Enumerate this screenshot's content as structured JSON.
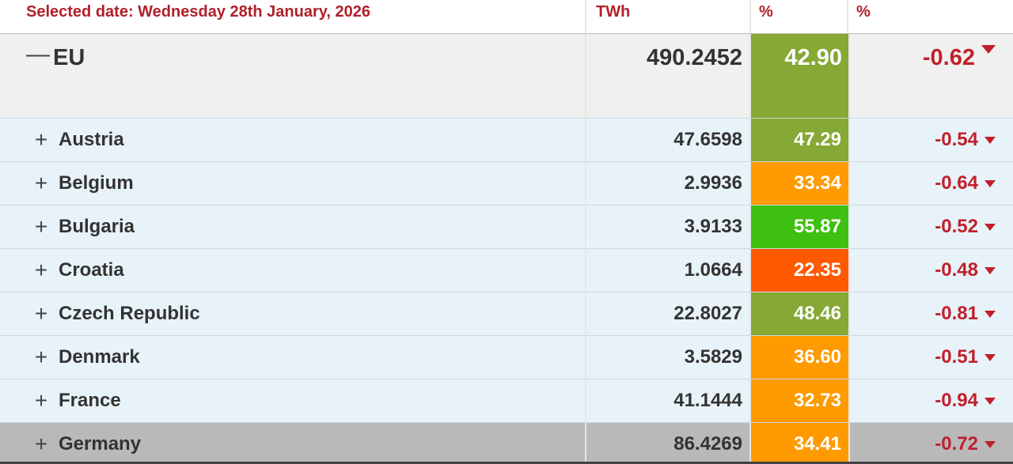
{
  "header": {
    "selected_date": "Selected date: Wednesday 28th January, 2026",
    "col_twh": "TWh",
    "col_pct": "%",
    "col_change": "%"
  },
  "colors": {
    "header_text": "#b0202a",
    "negative": "#c0202c",
    "pct_green_dark": "#86a834",
    "pct_green_bright": "#3fbf0f",
    "pct_orange": "#ff9a00",
    "pct_red_orange": "#ff5a00"
  },
  "eu": {
    "toggle": "—",
    "name": "EU",
    "twh": "490.2452",
    "pct": "42.90",
    "pct_color": "#86a834",
    "change": "-0.62"
  },
  "rows": [
    {
      "toggle": "+",
      "name": "Austria",
      "twh": "47.6598",
      "pct": "47.29",
      "pct_color": "#86a834",
      "change": "-0.54"
    },
    {
      "toggle": "+",
      "name": "Belgium",
      "twh": "2.9936",
      "pct": "33.34",
      "pct_color": "#ff9a00",
      "change": "-0.64"
    },
    {
      "toggle": "+",
      "name": "Bulgaria",
      "twh": "3.9133",
      "pct": "55.87",
      "pct_color": "#3fbf0f",
      "change": "-0.52"
    },
    {
      "toggle": "+",
      "name": "Croatia",
      "twh": "1.0664",
      "pct": "22.35",
      "pct_color": "#ff5a00",
      "change": "-0.48"
    },
    {
      "toggle": "+",
      "name": "Czech Republic",
      "twh": "22.8027",
      "pct": "48.46",
      "pct_color": "#86a834",
      "change": "-0.81"
    },
    {
      "toggle": "+",
      "name": "Denmark",
      "twh": "3.5829",
      "pct": "36.60",
      "pct_color": "#ff9a00",
      "change": "-0.51"
    },
    {
      "toggle": "+",
      "name": "France",
      "twh": "41.1444",
      "pct": "32.73",
      "pct_color": "#ff9a00",
      "change": "-0.94"
    },
    {
      "toggle": "+",
      "name": "Germany",
      "twh": "86.4269",
      "pct": "34.41",
      "pct_color": "#ff9a00",
      "change": "-0.72"
    }
  ]
}
